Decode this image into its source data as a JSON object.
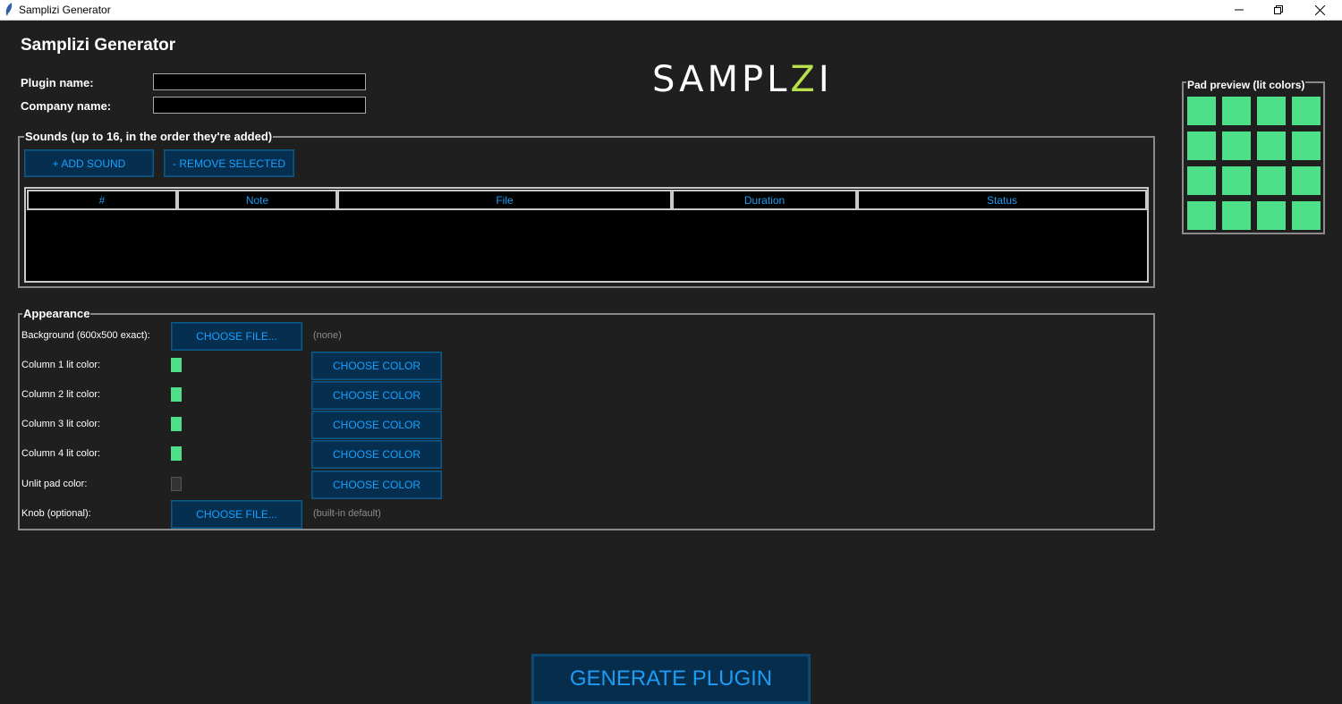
{
  "window": {
    "title": "Samplizi Generator"
  },
  "app": {
    "heading": "Samplizi Generator",
    "logo": {
      "pre": "SAMPL",
      "accent_letter": "Z",
      "post": "I",
      "accent_color": "#b8e04a"
    }
  },
  "form": {
    "plugin_name_label": "Plugin name:",
    "plugin_name_value": "",
    "company_name_label": "Company name:",
    "company_name_value": ""
  },
  "sounds": {
    "legend": "Sounds (up to 16, in the order they're added)",
    "add_button": "+ ADD SOUND",
    "remove_button": "- REMOVE SELECTED",
    "columns": [
      "#",
      "Note",
      "File",
      "Duration",
      "Status"
    ],
    "rows": []
  },
  "appearance": {
    "legend": "Appearance",
    "background_label": "Background (600x500 exact):",
    "background_button": "CHOOSE FILE...",
    "background_value": "(none)",
    "colors": [
      {
        "label": "Column 1 lit color:",
        "color": "#4ee088",
        "button": "CHOOSE COLOR"
      },
      {
        "label": "Column 2 lit color:",
        "color": "#4ee088",
        "button": "CHOOSE COLOR"
      },
      {
        "label": "Column 3 lit color:",
        "color": "#4ee088",
        "button": "CHOOSE COLOR"
      },
      {
        "label": "Column 4 lit color:",
        "color": "#4ee088",
        "button": "CHOOSE COLOR"
      },
      {
        "label": "Unlit pad color:",
        "color": "#333333",
        "button": "CHOOSE COLOR"
      }
    ],
    "knob_label": "Knob (optional):",
    "knob_button": "CHOOSE FILE...",
    "knob_value": "(built-in default)"
  },
  "pad_preview": {
    "legend": "Pad preview (lit colors)",
    "rows": 4,
    "cols": 4,
    "color": "#4ee088"
  },
  "generate_button": "GENERATE PLUGIN",
  "theme": {
    "accent_blue": "#18a0ff",
    "button_bg": "#062f4f",
    "background": "#1f1f1f"
  }
}
